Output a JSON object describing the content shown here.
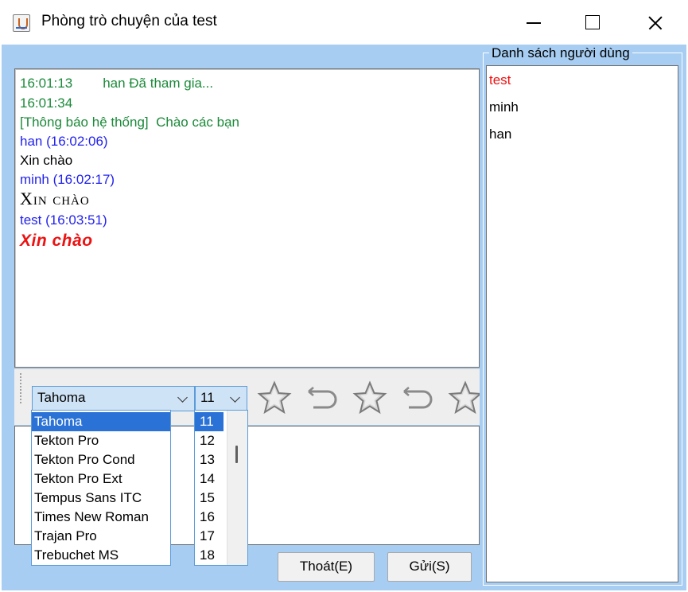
{
  "window": {
    "title": "Phòng trò chuyện của test"
  },
  "chat": {
    "lines": [
      {
        "time": "16:01:13",
        "text": "han Đã tham gia..."
      },
      {
        "time": "16:01:34"
      },
      {
        "system_label": "[Thông báo hệ thống]",
        "system_text": "Chào các bạn"
      },
      {
        "sender": "han  (16:02:06)"
      },
      {
        "message": "Xin chào"
      },
      {
        "sender": "minh  (16:02:17)"
      },
      {
        "message": "Xin chào"
      },
      {
        "sender": "test  (16:03:51)"
      },
      {
        "message": "Xin chào"
      }
    ]
  },
  "colors": {
    "system": "#1c8a3a",
    "sender": "#2222ee",
    "highlight_message": "#ee1111",
    "current_user": "#ee1111",
    "background": "#a7cdf2",
    "selection": "#2b72d6"
  },
  "toolbar": {
    "font_combo": "Tahoma",
    "size_combo": "11",
    "icons": [
      "star-icon",
      "undo-icon",
      "star-icon",
      "undo-icon",
      "star-icon"
    ]
  },
  "font_dropdown": {
    "options": [
      "Tahoma",
      "Tekton Pro",
      "Tekton Pro Cond",
      "Tekton Pro Ext",
      "Tempus Sans ITC",
      "Times New Roman",
      "Trajan Pro",
      "Trebuchet MS"
    ],
    "selected": "Tahoma"
  },
  "size_dropdown": {
    "options": [
      "11",
      "12",
      "13",
      "14",
      "15",
      "16",
      "17",
      "18"
    ],
    "selected": "11"
  },
  "buttons": {
    "exit": "Thoát(E)",
    "send": "Gửi(S)"
  },
  "users": {
    "title": "Danh sách người dùng",
    "items": [
      "test",
      "minh",
      "han"
    ]
  }
}
